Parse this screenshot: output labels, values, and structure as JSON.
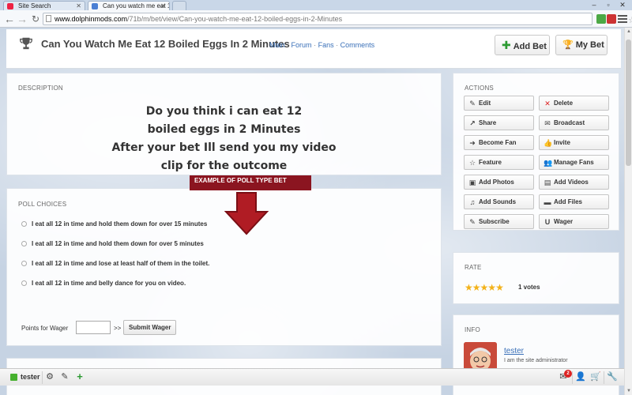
{
  "browser": {
    "tabs": [
      {
        "title": "Site Search",
        "active": false
      },
      {
        "title": "Can you watch me eat 12",
        "active": true
      }
    ],
    "url_host": "www.dolphinmods.com",
    "url_path": "/71b/m/bet/view/Can-you-watch-me-eat-12-boiled-eggs-in-2-Minutes"
  },
  "header": {
    "title": "Can You Watch Me Eat 12 Boiled Eggs In 2 Minutes",
    "links": [
      "Main",
      "Forum",
      "Fans",
      "Comments"
    ],
    "link_separator": "·",
    "add_bet_label": "Add Bet",
    "my_bet_label": "My Bet"
  },
  "description": {
    "label": "DESCRIPTION",
    "lines": [
      "Do you think i can eat 12",
      "boiled eggs in 2 Minutes",
      "After your bet Ill send you my video",
      "clip for the outcome"
    ]
  },
  "annotation": {
    "banner_text": "EXAMPLE OF POLL TYPE BET",
    "banner_color": "#8b1520",
    "arrow_color": "#b01c24"
  },
  "poll": {
    "label": "POLL CHOICES",
    "choices": [
      "I eat all 12 in time and hold them down for over 15 minutes",
      "I eat all 12 in time and hold them down for over 5 minutes",
      "I eat all 12 in time and lose at least half of them in the toilet.",
      "I eat all 12 in time and belly dance for you on video."
    ],
    "wager_label": "Points for Wager",
    "wager_value": "",
    "wager_arrow": ">>",
    "submit_label": "Submit Wager"
  },
  "actions": {
    "label": "ACTIONS",
    "buttons": [
      {
        "label": "Edit",
        "icon": "edit-icon",
        "glyph": "✎"
      },
      {
        "label": "Delete",
        "icon": "delete-icon",
        "glyph": "✕"
      },
      {
        "label": "Share",
        "icon": "share-icon",
        "glyph": "↗"
      },
      {
        "label": "Broadcast",
        "icon": "broadcast-icon",
        "glyph": "✉"
      },
      {
        "label": "Become Fan",
        "icon": "become-fan-icon",
        "glyph": "➜"
      },
      {
        "label": "Invite",
        "icon": "invite-icon",
        "glyph": "👍"
      },
      {
        "label": "Feature",
        "icon": "feature-icon",
        "glyph": "☆"
      },
      {
        "label": "Manage Fans",
        "icon": "manage-fans-icon",
        "glyph": "👥"
      },
      {
        "label": "Add Photos",
        "icon": "photos-icon",
        "glyph": "▣"
      },
      {
        "label": "Add Videos",
        "icon": "videos-icon",
        "glyph": "▤"
      },
      {
        "label": "Add Sounds",
        "icon": "sounds-icon",
        "glyph": "♫"
      },
      {
        "label": "Add Files",
        "icon": "files-icon",
        "glyph": "▬"
      },
      {
        "label": "Subscribe",
        "icon": "subscribe-icon",
        "glyph": "✎"
      },
      {
        "label": "Wager",
        "icon": "wager-icon",
        "glyph": "U"
      }
    ]
  },
  "rate": {
    "label": "RATE",
    "stars": 5,
    "stars_max": 5,
    "star_color": "#f3b21a",
    "votes_text": "1 votes"
  },
  "info": {
    "label": "INFO",
    "user_name": "tester",
    "user_role": "I am the site administrator"
  },
  "bottom_bar": {
    "user": "tester",
    "notification_count": "2"
  },
  "colors": {
    "link": "#3a70b8",
    "status_green": "#46b02e",
    "add_green": "#2c9a32"
  }
}
